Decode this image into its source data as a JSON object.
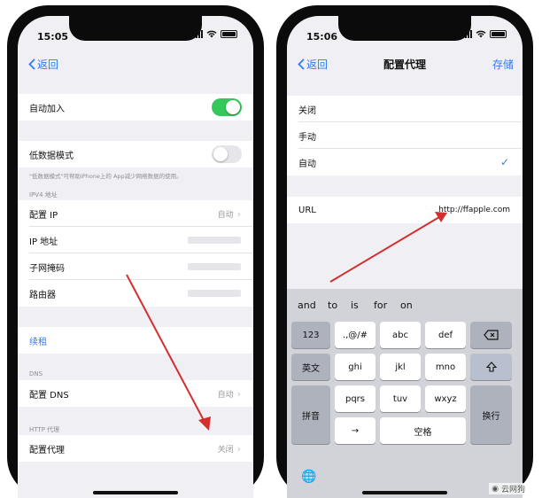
{
  "left_screen": {
    "status_time": "15:05",
    "back_label": "返回",
    "auto_join": {
      "label": "自动加入",
      "enabled": true
    },
    "low_data": {
      "label": "低数据模式",
      "enabled": false
    },
    "low_data_note": "\"低数据模式\"可帮助iPhone上的 App减少网络数据的使用。",
    "ipv4_header": "IPV4 地址",
    "ipv4_rows": [
      {
        "label": "配置 IP",
        "value": "自动"
      },
      {
        "label": "IP 地址",
        "value": ""
      },
      {
        "label": "子网掩码",
        "value": ""
      },
      {
        "label": "路由器",
        "value": ""
      }
    ],
    "renew_lease": "续租",
    "dns_header": "DNS",
    "dns_row": {
      "label": "配置 DNS",
      "value": "自动"
    },
    "http_header": "HTTP 代理",
    "proxy_row": {
      "label": "配置代理",
      "value": "关闭"
    }
  },
  "right_screen": {
    "status_time": "15:06",
    "back_label": "返回",
    "title": "配置代理",
    "save_label": "存储",
    "options": [
      {
        "label": "关闭",
        "selected": false
      },
      {
        "label": "手动",
        "selected": false
      },
      {
        "label": "自动",
        "selected": true
      }
    ],
    "url_label": "URL",
    "url_value": "http://ffapple.com",
    "keyboard": {
      "suggestions": [
        "and",
        "to",
        "is",
        "for",
        "on"
      ],
      "row1": [
        "123",
        ".,@/#",
        "abc",
        "def"
      ],
      "row2": [
        "英文",
        "ghi",
        "jkl",
        "mno"
      ],
      "row3": [
        "拼音",
        "pqrs",
        "tuv",
        "wxyz"
      ],
      "space": "空格",
      "arrow_key": "→",
      "return_key": "换行"
    }
  },
  "watermark": "云网狗",
  "colors": {
    "accent": "#3478f6",
    "toggle_on": "#34c759",
    "arrow": "#d32f2f"
  }
}
